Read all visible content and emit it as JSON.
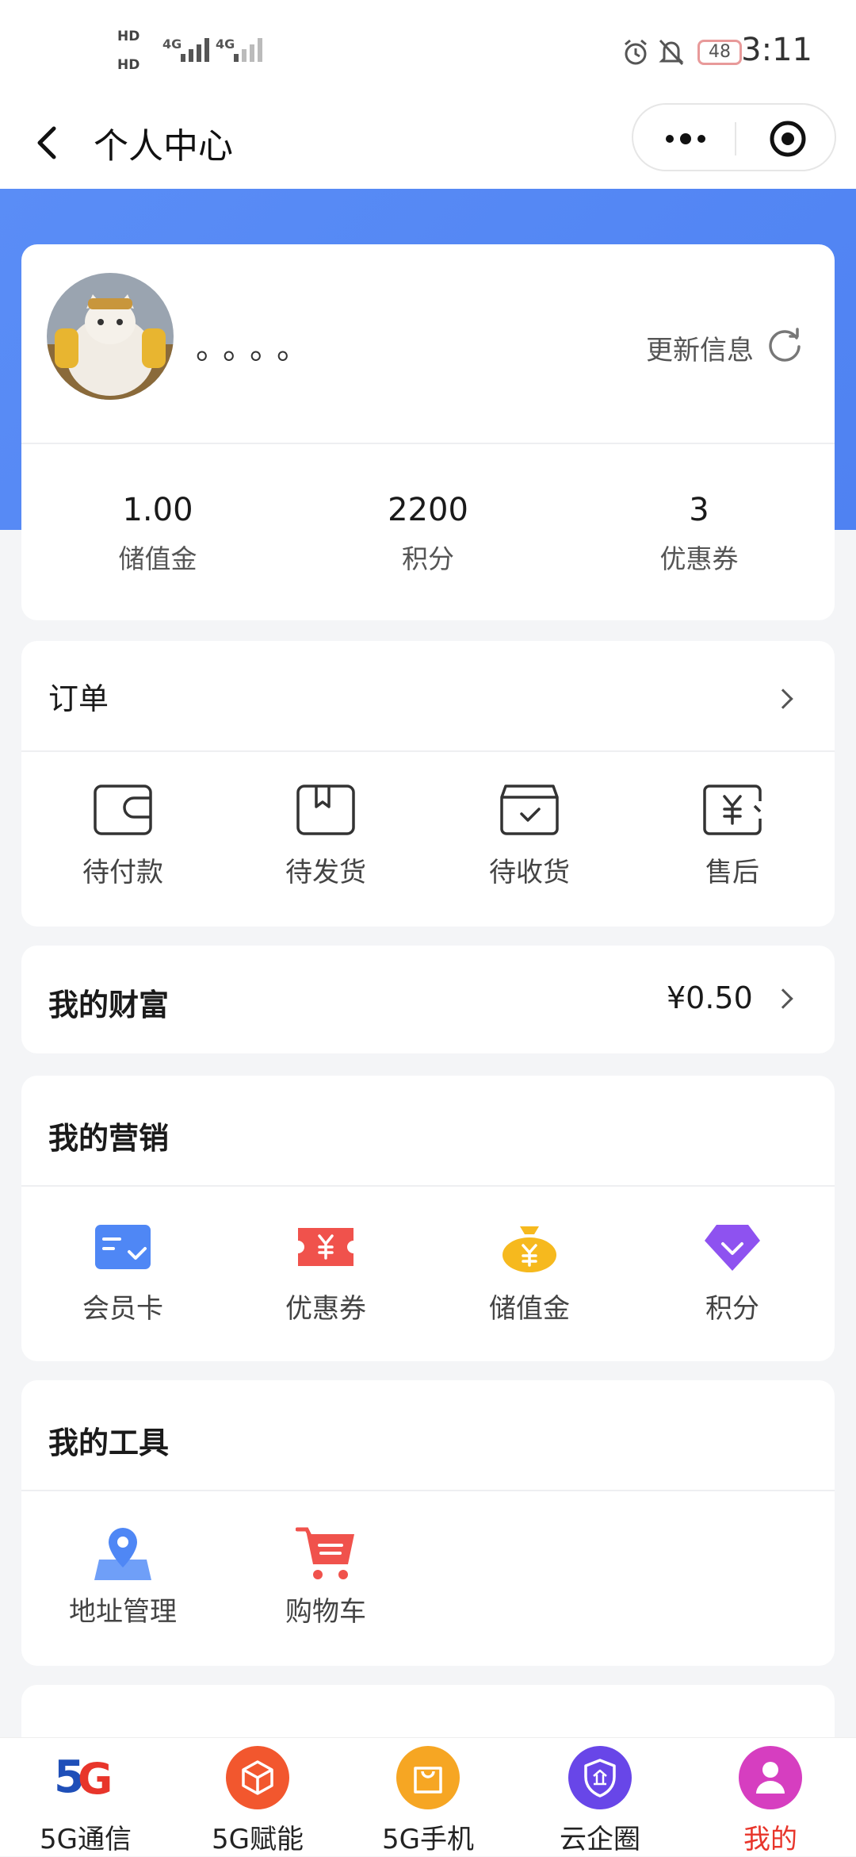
{
  "status_bar": {
    "hd1": "HD",
    "hd2": "HD",
    "net1": "4G",
    "net2": "4G",
    "battery": "48",
    "time": "3:11"
  },
  "nav": {
    "title": "个人中心"
  },
  "profile": {
    "nickname": "。。。。",
    "update_label": "更新信息",
    "stats": [
      {
        "value": "1.00",
        "label": "储值金"
      },
      {
        "value": "2200",
        "label": "积分"
      },
      {
        "value": "3",
        "label": "优惠券"
      }
    ]
  },
  "orders": {
    "title": "订单",
    "items": [
      {
        "label": "待付款",
        "icon": "wallet-icon"
      },
      {
        "label": "待发货",
        "icon": "package-icon"
      },
      {
        "label": "待收货",
        "icon": "receive-box-icon"
      },
      {
        "label": "售后",
        "icon": "after-sale-icon"
      }
    ]
  },
  "wealth": {
    "title": "我的财富",
    "amount": "¥0.50"
  },
  "marketing": {
    "title": "我的营销",
    "items": [
      {
        "label": "会员卡",
        "icon": "member-card-icon",
        "color": "#4f87f5"
      },
      {
        "label": "优惠券",
        "icon": "coupon-icon",
        "color": "#f0524c"
      },
      {
        "label": "储值金",
        "icon": "money-bag-icon",
        "color": "#f6b91e"
      },
      {
        "label": "积分",
        "icon": "diamond-icon",
        "color": "#8e52f0"
      }
    ]
  },
  "tools": {
    "title": "我的工具",
    "items": [
      {
        "label": "地址管理",
        "icon": "location-icon",
        "color": "#4f87f5"
      },
      {
        "label": "购物车",
        "icon": "cart-icon",
        "color": "#f0524c"
      }
    ]
  },
  "tabbar": {
    "items": [
      {
        "label": "5G通信",
        "icon": "5g-logo-icon"
      },
      {
        "label": "5G赋能",
        "icon": "cube-icon",
        "color": "#f2572e"
      },
      {
        "label": "5G手机",
        "icon": "shopping-bag-icon",
        "color": "#f6a623"
      },
      {
        "label": "云企圈",
        "icon": "enterprise-shield-icon",
        "color": "#6846e8"
      },
      {
        "label": "我的",
        "icon": "user-icon",
        "color": "#d63ec0",
        "active": true,
        "active_color": "#e8352b"
      }
    ]
  }
}
